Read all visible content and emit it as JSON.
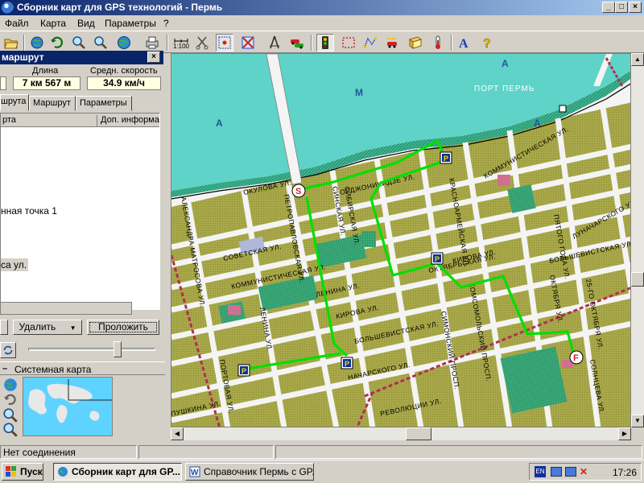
{
  "window": {
    "title": "Сборник карт для GPS технологий - Пермь",
    "controls": {
      "minimize": "_",
      "maximize": "□",
      "close": "×"
    }
  },
  "menu": [
    {
      "label": "Файл"
    },
    {
      "label": "Карта"
    },
    {
      "label": "Вид"
    },
    {
      "label": "Параметры"
    },
    {
      "label": "?"
    }
  ],
  "toolbar": {
    "scale_label": "1:100",
    "icons": [
      "open-folder",
      "globe-refresh",
      "undo",
      "zoom-in",
      "zoom-out",
      "globe",
      "print",
      "scale",
      "scissors",
      "target",
      "cross-out",
      "compass",
      "cars",
      "traffic-light",
      "select-rect",
      "select-polyline",
      "car-route",
      "book",
      "thermometer",
      "text-font",
      "help"
    ]
  },
  "route_panel": {
    "title": "маршрут",
    "length_label": "Длина",
    "length_value": "7 км 567 м",
    "speed_label": "Средн. скорость",
    "speed_value": "34.9 км/ч",
    "tabs": [
      {
        "label": "шрута"
      },
      {
        "label": "Маршрут"
      },
      {
        "label": "Параметры"
      }
    ],
    "columns": [
      "рта",
      "Доп. информа"
    ],
    "rows": [
      "нная точка 1",
      "са ул."
    ],
    "delete_label": "Удалить",
    "lay_route_label": "Проложить"
  },
  "system_map": {
    "title": "Системная карта"
  },
  "map": {
    "water_labels": [
      "А",
      "М",
      "А",
      "А"
    ],
    "port_label": "ПОРТ ПЕРМЬ",
    "street_labels": [
      "АЛЕКСАНДРА МАТРОСОВА УЛ.",
      "СОВЕТСКАЯ УЛ.",
      "КОММУНИСТИЧЕСКАЯ УЛ.",
      "ЛЕНИНА УЛ.",
      "КИРОВА УЛ.",
      "БОЛЬШЕВИСТСКАЯ УЛ.",
      "ПУШКИНА УЛ.",
      "РЕВОЛЮЦИИ УЛ.",
      "ОКТЯБРЬСКАЯ УЛ.",
      "СИБИРСКАЯ УЛ.",
      "КРАСНОАРМЕЙСКАЯ УЛ.",
      "ПЕТРОПАВЛОВСКАЯ УЛ.",
      "ОКУЛОВА УЛ.",
      "СИНСКАЯ УЛ.",
      "ОРДЖОНИКИДЗЕ УЛ.",
      "КОМСОМОЛЬСКИЙ ПРОСП.",
      "КИРОВА УЛ.",
      "ОКТЯБРЯ УЛ.",
      "25-ГО ОКТЯБРЯ УЛ.",
      "КОММУНИСТИЧЕСКАЯ УЛ.",
      "БОЛЬШЕВИСТСКАЯ УЛ.",
      "ПЯТОГО ГОДА УЛ.",
      "ЛУНАЧАРСКОГО УЛ.",
      "ПОРТОВАЯ УЛ.",
      "НАЧАРСКОГО УЛ.",
      "ЛЕНИНА УЛ.",
      "СИМОНСКИЙ ПРОСП.",
      "СОЛНЦЕВА УЛ."
    ],
    "route_markers": [
      {
        "letter": "S",
        "kind": "start"
      },
      {
        "letter": "P",
        "kind": "waypoint"
      },
      {
        "letter": "P",
        "kind": "waypoint"
      },
      {
        "letter": "P",
        "kind": "waypoint"
      },
      {
        "letter": "P",
        "kind": "waypoint"
      },
      {
        "letter": "F",
        "kind": "finish"
      }
    ]
  },
  "status": {
    "connection": "Нет соединения"
  },
  "taskbar": {
    "start_label": "Пуск",
    "tasks": [
      {
        "label": "Сборник карт для GP...",
        "active": true
      },
      {
        "label": "Справочник Пермь с GP...",
        "active": false
      }
    ],
    "lang": "EN",
    "clock": "17:26"
  },
  "colors": {
    "title_bar": "#0a246a",
    "water": "#5fd3c8",
    "blocks": "#a8a84a",
    "park": "#2f9a6e",
    "route": "#00e000",
    "railway": "#b03050"
  }
}
